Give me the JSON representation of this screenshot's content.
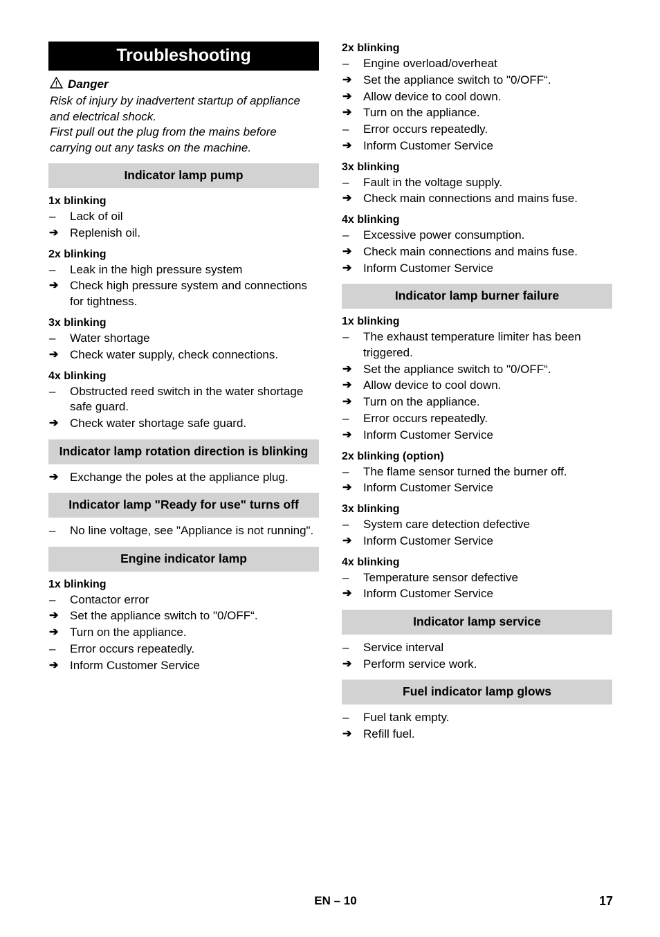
{
  "document": {
    "chapter_title": "Troubleshooting",
    "footer": {
      "center": "EN – 10",
      "page_number": "17"
    },
    "colors": {
      "chapter_bar_bg": "#000000",
      "chapter_bar_text": "#ffffff",
      "section_bar_bg": "#d2d2d2",
      "text": "#000000",
      "page_bg": "#ffffff"
    },
    "markers": {
      "dash": "–",
      "arrow": "➔"
    }
  },
  "danger": {
    "icon": "warning-triangle-icon",
    "label": "Danger",
    "paragraph_1": "Risk of injury by inadvertent startup of appliance and electrical shock.",
    "paragraph_2": "First pull out the plug from the mains before carrying out any tasks on the machine."
  },
  "left_column": {
    "sections": [
      {
        "heading": "Indicator lamp pump",
        "groups": [
          {
            "sub_head": "1x blinking",
            "items": [
              {
                "marker": "dash",
                "text": "Lack of oil"
              },
              {
                "marker": "arrow",
                "text": "Replenish oil."
              }
            ]
          },
          {
            "sub_head": "2x blinking",
            "items": [
              {
                "marker": "dash",
                "text": "Leak in the high pressure system"
              },
              {
                "marker": "arrow",
                "text": "Check high pressure system and connections for tightness."
              }
            ]
          },
          {
            "sub_head": "3x blinking",
            "items": [
              {
                "marker": "dash",
                "text": "Water shortage"
              },
              {
                "marker": "arrow",
                "text": "Check water supply, check connections."
              }
            ]
          },
          {
            "sub_head": "4x blinking",
            "items": [
              {
                "marker": "dash",
                "text": "Obstructed reed switch in the water shortage safe guard."
              },
              {
                "marker": "arrow",
                "text": "Check water shortage safe guard."
              }
            ]
          }
        ]
      },
      {
        "heading": "Indicator lamp rotation direction is blinking",
        "groups": [
          {
            "sub_head": "",
            "items": [
              {
                "marker": "arrow",
                "text": "Exchange the poles at the appliance plug."
              }
            ]
          }
        ]
      },
      {
        "heading": "Indicator lamp \"Ready for use\" turns off",
        "groups": [
          {
            "sub_head": "",
            "items": [
              {
                "marker": "dash",
                "text": "No line voltage, see \"Appliance is not running\"."
              }
            ]
          }
        ]
      },
      {
        "heading": "Engine indicator lamp",
        "groups": [
          {
            "sub_head": "1x blinking",
            "items": [
              {
                "marker": "dash",
                "text": "Contactor error"
              },
              {
                "marker": "arrow",
                "text": "Set the appliance switch to \"0/OFF“."
              },
              {
                "marker": "arrow",
                "text": "Turn on the appliance."
              },
              {
                "marker": "dash",
                "text": "Error occurs repeatedly."
              },
              {
                "marker": "arrow",
                "text": "Inform Customer Service"
              }
            ]
          }
        ]
      }
    ]
  },
  "right_column": {
    "sections": [
      {
        "heading": "",
        "groups": [
          {
            "sub_head": "2x blinking",
            "items": [
              {
                "marker": "dash",
                "text": "Engine overload/overheat"
              },
              {
                "marker": "arrow",
                "text": "Set the appliance switch to \"0/OFF“."
              },
              {
                "marker": "arrow",
                "text": "Allow device to cool down."
              },
              {
                "marker": "arrow",
                "text": "Turn on the appliance."
              },
              {
                "marker": "dash",
                "text": "Error occurs repeatedly."
              },
              {
                "marker": "arrow",
                "text": "Inform Customer Service"
              }
            ]
          },
          {
            "sub_head": "3x blinking",
            "items": [
              {
                "marker": "dash",
                "text": "Fault in the voltage supply."
              },
              {
                "marker": "arrow",
                "text": "Check main connections and mains fuse."
              }
            ]
          },
          {
            "sub_head": "4x blinking",
            "items": [
              {
                "marker": "dash",
                "text": "Excessive power consumption."
              },
              {
                "marker": "arrow",
                "text": "Check main connections and mains fuse."
              },
              {
                "marker": "arrow",
                "text": "Inform Customer Service"
              }
            ]
          }
        ]
      },
      {
        "heading": "Indicator lamp burner failure",
        "groups": [
          {
            "sub_head": "1x blinking",
            "items": [
              {
                "marker": "dash",
                "text": "The exhaust temperature limiter has been triggered."
              },
              {
                "marker": "arrow",
                "text": "Set the appliance switch to \"0/OFF“."
              },
              {
                "marker": "arrow",
                "text": "Allow device to cool down."
              },
              {
                "marker": "arrow",
                "text": "Turn on the appliance."
              },
              {
                "marker": "dash",
                "text": "Error occurs repeatedly."
              },
              {
                "marker": "arrow",
                "text": "Inform Customer Service"
              }
            ]
          },
          {
            "sub_head": "2x blinking (option)",
            "items": [
              {
                "marker": "dash",
                "text": "The flame sensor turned the burner off."
              },
              {
                "marker": "arrow",
                "text": "Inform Customer Service"
              }
            ]
          },
          {
            "sub_head": "3x blinking",
            "items": [
              {
                "marker": "dash",
                "text": "System care detection defective"
              },
              {
                "marker": "arrow",
                "text": "Inform Customer Service"
              }
            ]
          },
          {
            "sub_head": "4x blinking",
            "items": [
              {
                "marker": "dash",
                "text": "Temperature sensor defective"
              },
              {
                "marker": "arrow",
                "text": "Inform Customer Service"
              }
            ]
          }
        ]
      },
      {
        "heading": "Indicator lamp service",
        "groups": [
          {
            "sub_head": "",
            "items": [
              {
                "marker": "dash",
                "text": "Service interval"
              },
              {
                "marker": "arrow",
                "text": "Perform service work."
              }
            ]
          }
        ]
      },
      {
        "heading": "Fuel indicator lamp glows",
        "groups": [
          {
            "sub_head": "",
            "items": [
              {
                "marker": "dash",
                "text": "Fuel tank empty."
              },
              {
                "marker": "arrow",
                "text": "Refill fuel."
              }
            ]
          }
        ]
      }
    ]
  }
}
